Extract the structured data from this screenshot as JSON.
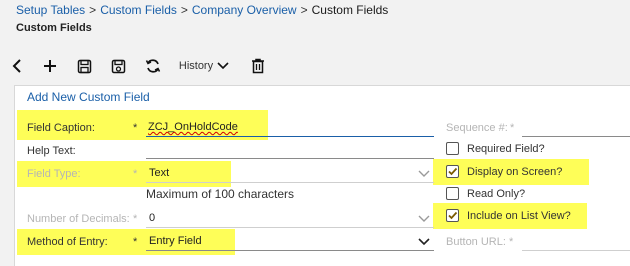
{
  "breadcrumb": {
    "items": [
      "Setup Tables",
      "Custom Fields",
      "Company Overview",
      "Custom Fields"
    ],
    "separator": ">"
  },
  "page_title": "Custom Fields",
  "toolbar": {
    "history_label": "History",
    "icons": [
      "back-icon",
      "add-icon",
      "save-icon",
      "save-as-icon",
      "refresh-icon",
      "history-dropdown",
      "delete-icon"
    ]
  },
  "form": {
    "title": "Add New Custom Field",
    "field_caption": {
      "label": "Field Caption:",
      "required": "*",
      "value": "ZCJ_OnHoldCode"
    },
    "help_text": {
      "label": "Help Text:",
      "value": ""
    },
    "field_type": {
      "label": "Field Type:",
      "required": "*",
      "value": "Text",
      "hint": "Maximum of 100 characters"
    },
    "number_of_decimals": {
      "label": "Number of Decimals:",
      "required": "*",
      "value": "0"
    },
    "method_of_entry": {
      "label": "Method of Entry:",
      "required": "*",
      "value": "Entry Field"
    },
    "sequence": {
      "label": "Sequence #:",
      "required": "*",
      "value": ""
    },
    "button_url": {
      "label": "Button URL:",
      "required": "*",
      "value": ""
    },
    "checkboxes": [
      {
        "label": "Required Field?",
        "checked": false
      },
      {
        "label": "Display on Screen?",
        "checked": true
      },
      {
        "label": "Read Only?",
        "checked": false
      },
      {
        "label": "Include on List View?",
        "checked": true
      }
    ]
  },
  "colors": {
    "highlight": "#fefe58",
    "link": "#1a5fa8",
    "background": "#f2f2f2"
  }
}
